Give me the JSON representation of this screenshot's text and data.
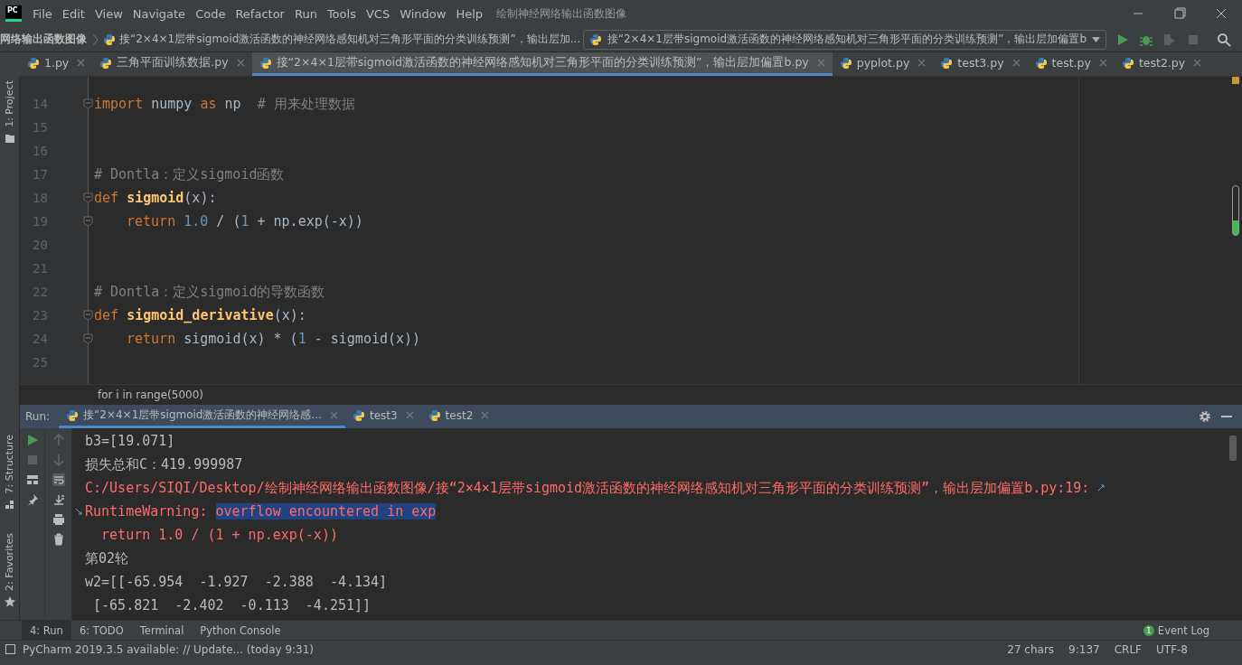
{
  "menu_bar": {
    "logo": "PC",
    "items": [
      "File",
      "Edit",
      "View",
      "Navigate",
      "Code",
      "Refactor",
      "Run",
      "Tools",
      "VCS",
      "Window",
      "Help"
    ],
    "project_title": "绘制神经网络输出函数图像"
  },
  "nav_bar": {
    "crumbs": [
      "网络输出函数图像",
      "接“2×4×1层带sigmoid激活函数的神经网络感知机对三角形平面的分类训练预测”，输出层加..."
    ],
    "run_config": "接“2×4×1层带sigmoid激活函数的神经网络感知机对三角形平面的分类训练预测”，输出层加偏置b"
  },
  "editor_tabs": [
    {
      "label": "1.py",
      "selected": false
    },
    {
      "label": "三角平面训练数据.py",
      "selected": false
    },
    {
      "label": "接“2×4×1层带sigmoid激活函数的神经网络感知机对三角形平面的分类训练预测”，输出层加偏置b.py",
      "selected": true
    },
    {
      "label": "pyplot.py",
      "selected": false
    },
    {
      "label": "test3.py",
      "selected": false
    },
    {
      "label": "test.py",
      "selected": false
    },
    {
      "label": "test2.py",
      "selected": false
    }
  ],
  "left_tool_strip": {
    "top": "1: Project",
    "bottom": [
      "7: Structure",
      "2: Favorites"
    ]
  },
  "code_lines": [
    {
      "number": "14",
      "fold": true,
      "tokens": [
        {
          "kind": "keyword",
          "text": "import"
        },
        {
          "kind": "plain",
          "text": " numpy "
        },
        {
          "kind": "keyword",
          "text": "as"
        },
        {
          "kind": "plain",
          "text": " np  "
        },
        {
          "kind": "comment",
          "text": "# 用来处理数据"
        }
      ]
    },
    {
      "number": "15",
      "fold": false
    },
    {
      "number": "16",
      "fold": false
    },
    {
      "number": "17",
      "fold": false,
      "tokens": [
        {
          "kind": "comment",
          "text": "# Dontla：定义sigmoid函数"
        }
      ]
    },
    {
      "number": "18",
      "fold": true,
      "tokens": [
        {
          "kind": "keyword",
          "text": "def "
        },
        {
          "kind": "func",
          "text": "sigmoid"
        },
        {
          "kind": "plain",
          "text": "(x):"
        }
      ],
      "children": [
        {
          "number": "19",
          "fold": true,
          "tokens": [
            {
              "kind": "keyword",
              "text": "return "
            },
            {
              "kind": "number",
              "text": "1.0"
            },
            {
              "kind": "plain",
              "text": " / ("
            },
            {
              "kind": "number",
              "text": "1"
            },
            {
              "kind": "plain",
              "text": " + np.exp(-x))"
            }
          ]
        }
      ]
    },
    {
      "number": "20",
      "fold": false
    },
    {
      "number": "21",
      "fold": false
    },
    {
      "number": "22",
      "fold": false,
      "tokens": [
        {
          "kind": "comment",
          "text": "# Dontla：定义sigmoid的导数函数"
        }
      ]
    },
    {
      "number": "23",
      "fold": true,
      "tokens": [
        {
          "kind": "keyword",
          "text": "def "
        },
        {
          "kind": "func",
          "text": "sigmoid_derivative"
        },
        {
          "kind": "plain",
          "text": "(x):"
        }
      ],
      "children": [
        {
          "number": "24",
          "fold": true,
          "tokens": [
            {
              "kind": "keyword",
              "text": "return "
            },
            {
              "kind": "plain",
              "text": "sigmoid(x) * ("
            },
            {
              "kind": "number",
              "text": "1"
            },
            {
              "kind": "plain",
              "text": " - sigmoid(x))"
            }
          ]
        }
      ]
    },
    {
      "number": "25",
      "fold": false
    }
  ],
  "breadcrumb": "for i in range(5000)",
  "run_panel": {
    "label": "Run:",
    "tabs": [
      {
        "label": "接“2×4×1层带sigmoid激活函数的神经网络感...",
        "selected": true
      },
      {
        "label": "test3",
        "selected": false
      },
      {
        "label": "test2",
        "selected": false
      }
    ],
    "console_lines": [
      {
        "kind": "normal",
        "parts": [
          {
            "text": "b3=[19.071]",
            "selected": false
          }
        ]
      },
      {
        "kind": "normal",
        "parts": [
          {
            "text": "损失总和C：419.999987",
            "selected": false
          }
        ]
      },
      {
        "kind": "link",
        "parts": [
          {
            "text": "C:/Users/SIQI/Desktop/绘制神经网络输出函数图像/接“2×4×1层带sigmoid激活函数的神经网络感知机对三角形平面的分类训练预测”，输出层加偏置b.py:19",
            "selected": false
          },
          {
            "text": ":",
            "selected": false
          }
        ]
      },
      {
        "kind": "error",
        "parts": [
          {
            "text": "RuntimeWarning: ",
            "selected": false
          },
          {
            "text": "overflow encountered in exp",
            "selected": true
          }
        ]
      },
      {
        "kind": "error",
        "parts": [
          {
            "text": "  return 1.0 / (1 + np.exp(-x))",
            "selected": false
          }
        ]
      },
      {
        "kind": "normal",
        "parts": [
          {
            "text": "第02轮",
            "selected": false
          }
        ]
      },
      {
        "kind": "normal",
        "parts": [
          {
            "text": "w2=[[-65.954  -1.927  -2.388  -4.134]",
            "selected": false
          }
        ]
      },
      {
        "kind": "normal",
        "parts": [
          {
            "text": " [-65.821  -2.402  -0.113  -4.251]]",
            "selected": false
          }
        ]
      }
    ]
  },
  "tool_tabs": [
    {
      "label": "4: Run",
      "selected": true
    },
    {
      "label": "6: TODO",
      "selected": false
    },
    {
      "label": "Terminal",
      "selected": false
    },
    {
      "label": "Python Console",
      "selected": false
    }
  ],
  "event_log": {
    "count": "1",
    "label": "Event Log"
  },
  "status_bar": {
    "message": "PyCharm 2019.3.5 available: // Update... (today 9:31)",
    "items": [
      "27 chars",
      "9:137",
      "CRLF",
      "UTF-8"
    ]
  }
}
